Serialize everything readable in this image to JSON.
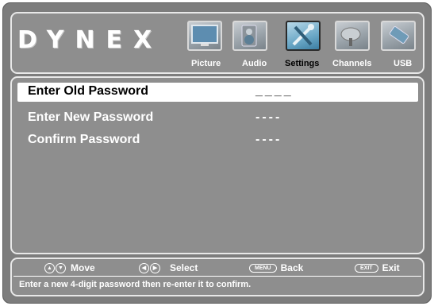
{
  "brand": "DYNEX",
  "tabs": [
    {
      "label": "Picture",
      "icon": "tv-screen-icon",
      "active": false
    },
    {
      "label": "Audio",
      "icon": "speaker-icon",
      "active": false
    },
    {
      "label": "Settings",
      "icon": "tools-icon",
      "active": true
    },
    {
      "label": "Channels",
      "icon": "satellite-dish-icon",
      "active": false
    },
    {
      "label": "USB",
      "icon": "usb-drive-icon",
      "active": false
    }
  ],
  "rows": [
    {
      "label": "Enter Old Password",
      "value": "____",
      "selected": true
    },
    {
      "label": "Enter New Password",
      "value": "----",
      "selected": false
    },
    {
      "label": "Confirm Password",
      "value": "----",
      "selected": false
    }
  ],
  "hints": [
    {
      "key": "",
      "label": "Move"
    },
    {
      "key": "",
      "label": "Select"
    },
    {
      "key": "MENU",
      "label": "Back"
    },
    {
      "key": "EXIT",
      "label": "Exit"
    }
  ],
  "help_text": "Enter a new 4-digit password then re-enter it to confirm.",
  "colors": {
    "background": "#8e8e8e",
    "highlight": "#ffffff",
    "active_tab": "#6aa7c6"
  }
}
